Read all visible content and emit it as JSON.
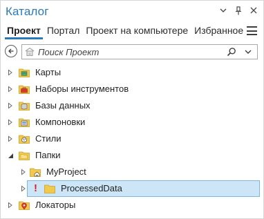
{
  "window": {
    "title": "Каталог",
    "controls": {
      "dropdown_glyph": "▾",
      "pin_glyph": "ᵠ",
      "close_glyph": "✕"
    }
  },
  "tabs": [
    {
      "label": "Проект",
      "active": true
    },
    {
      "label": "Портал",
      "active": false
    },
    {
      "label": "Проект на компьютере",
      "active": false
    },
    {
      "label": "Избранное",
      "active": false
    }
  ],
  "search": {
    "placeholder": "Поиск Проект",
    "value": ""
  },
  "tree": {
    "items": [
      {
        "label": "Карты",
        "icon": "maps-folder-icon",
        "expanded": false
      },
      {
        "label": "Наборы инструментов",
        "icon": "toolboxes-folder-icon",
        "expanded": false
      },
      {
        "label": "Базы данных",
        "icon": "databases-folder-icon",
        "expanded": false
      },
      {
        "label": "Компоновки",
        "icon": "layouts-folder-icon",
        "expanded": false
      },
      {
        "label": "Стили",
        "icon": "styles-folder-icon",
        "expanded": false
      },
      {
        "label": "Папки",
        "icon": "folders-folder-icon",
        "expanded": true
      },
      {
        "label": "MyProject",
        "icon": "home-folder-icon",
        "expanded": false
      },
      {
        "label": "ProcessedData",
        "icon": "folder-icon",
        "expanded": false,
        "selected": true,
        "warning": "!"
      },
      {
        "label": "Локаторы",
        "icon": "locators-folder-icon",
        "expanded": false
      }
    ]
  },
  "colors": {
    "accent": "#2a7ab8",
    "selection_bg": "#cce6f7",
    "selection_border": "#7ab6de",
    "folder": "#f2c94c",
    "warning": "#d42020"
  }
}
